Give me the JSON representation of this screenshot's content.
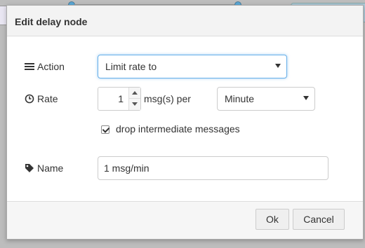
{
  "dialog": {
    "title": "Edit delay node"
  },
  "action": {
    "label": "Action",
    "selected": "Limit rate to"
  },
  "rate": {
    "label": "Rate",
    "value": "1",
    "unit_text": "msg(s) per",
    "period": "Minute"
  },
  "drop": {
    "label": "drop intermediate messages",
    "checked": true
  },
  "name": {
    "label": "Name",
    "value": "1 msg/min"
  },
  "buttons": {
    "ok": "Ok",
    "cancel": "Cancel"
  },
  "icons": {
    "action": "list-icon",
    "rate": "clock-icon",
    "name": "tag-icon"
  }
}
